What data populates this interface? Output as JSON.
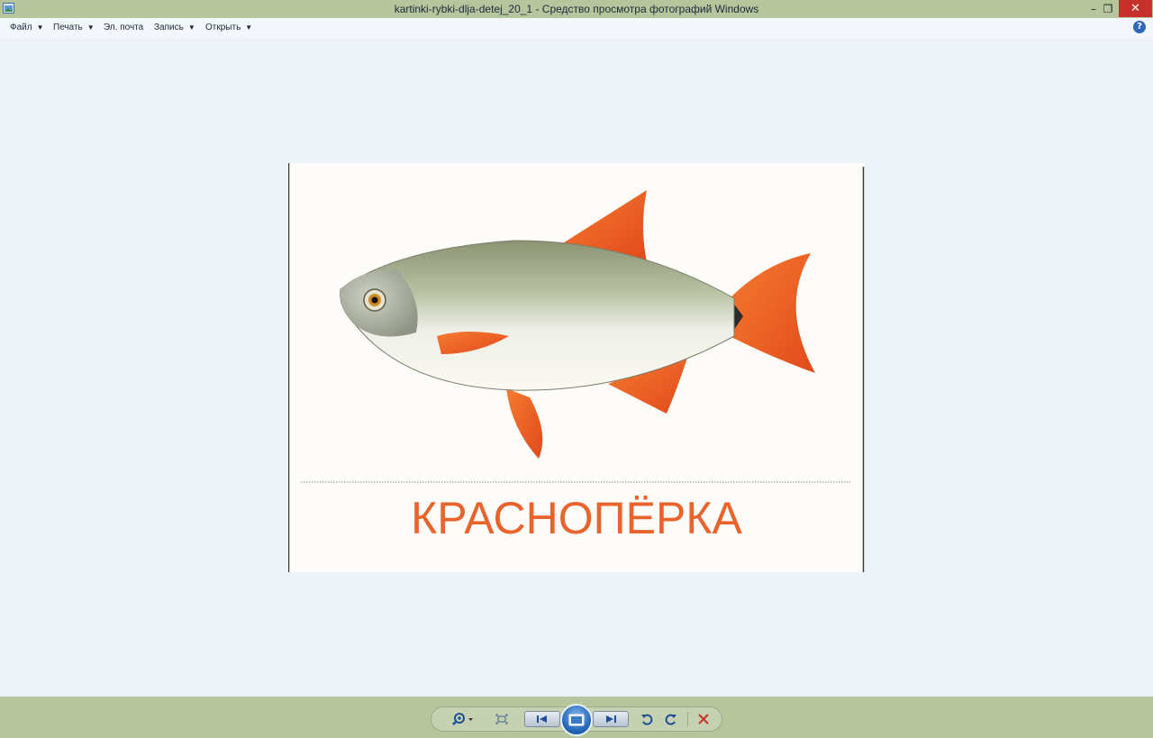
{
  "window": {
    "title": "kartinki-rybki-dlja-detej_20_1 - Средство просмотра фотографий Windows",
    "minimize_glyph": "–",
    "restore_glyph": "❐",
    "close_glyph": "✕"
  },
  "menu": {
    "items": [
      {
        "label": "Файл",
        "has_arrow": true
      },
      {
        "label": "Печать",
        "has_arrow": true
      },
      {
        "label": "Эл. почта",
        "has_arrow": false
      },
      {
        "label": "Запись",
        "has_arrow": true
      },
      {
        "label": "Открыть",
        "has_arrow": true
      }
    ],
    "arrow_glyph": "▼",
    "help_glyph": "?"
  },
  "photo": {
    "caption": "КРАСНОПЁРКА",
    "caption_color": "#e8642c"
  },
  "toolbar": {
    "icons": [
      "zoom-icon",
      "fit-to-window-icon",
      "previous-icon",
      "slideshow-icon",
      "next-icon",
      "rotate-left-icon",
      "rotate-right-icon",
      "delete-icon"
    ]
  }
}
